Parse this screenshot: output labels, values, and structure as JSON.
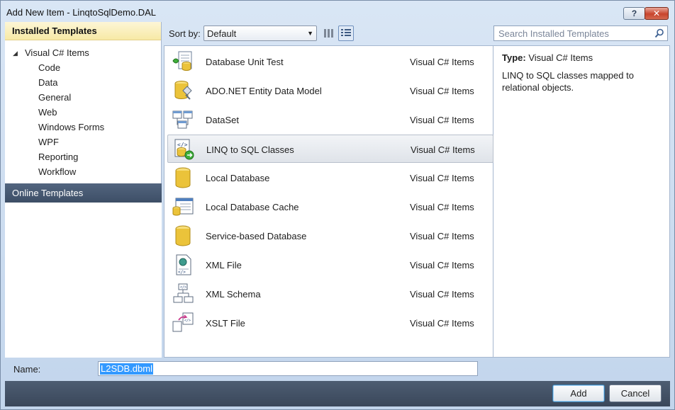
{
  "window": {
    "title": "Add New Item - LinqtoSqlDemo.DAL",
    "help_glyph": "?",
    "close_glyph": "✕"
  },
  "sidebar": {
    "installed_header": "Installed Templates",
    "root": "Visual C# Items",
    "items": [
      "Code",
      "Data",
      "General",
      "Web",
      "Windows Forms",
      "WPF",
      "Reporting",
      "Workflow"
    ],
    "online": "Online Templates"
  },
  "toolbar": {
    "sort_label": "Sort by:",
    "sort_value": "Default",
    "search_placeholder": "Search Installed Templates"
  },
  "templates": [
    {
      "name": "Database Unit Test",
      "category": "Visual C# Items",
      "icon": "database-unit-test-icon"
    },
    {
      "name": "ADO.NET Entity Data Model",
      "category": "Visual C# Items",
      "icon": "entity-data-model-icon"
    },
    {
      "name": "DataSet",
      "category": "Visual C# Items",
      "icon": "dataset-icon"
    },
    {
      "name": "LINQ to SQL Classes",
      "category": "Visual C# Items",
      "icon": "linq-to-sql-icon"
    },
    {
      "name": "Local Database",
      "category": "Visual C# Items",
      "icon": "local-database-icon"
    },
    {
      "name": "Local Database Cache",
      "category": "Visual C# Items",
      "icon": "local-database-cache-icon"
    },
    {
      "name": "Service-based Database",
      "category": "Visual C# Items",
      "icon": "service-database-icon"
    },
    {
      "name": "XML File",
      "category": "Visual C# Items",
      "icon": "xml-file-icon"
    },
    {
      "name": "XML Schema",
      "category": "Visual C# Items",
      "icon": "xml-schema-icon"
    },
    {
      "name": "XSLT File",
      "category": "Visual C# Items",
      "icon": "xslt-file-icon"
    }
  ],
  "description": {
    "type_label": "Type:",
    "type_value": "Visual C# Items",
    "text": "LINQ to SQL classes mapped to relational objects."
  },
  "name_field": {
    "label": "Name:",
    "value": "L2SDB.dbml"
  },
  "buttons": {
    "add": "Add",
    "cancel": "Cancel"
  },
  "colors": {
    "selection": "#3399ff",
    "online_bar": "#46576e",
    "installed_bar": "#f7e9a5"
  }
}
